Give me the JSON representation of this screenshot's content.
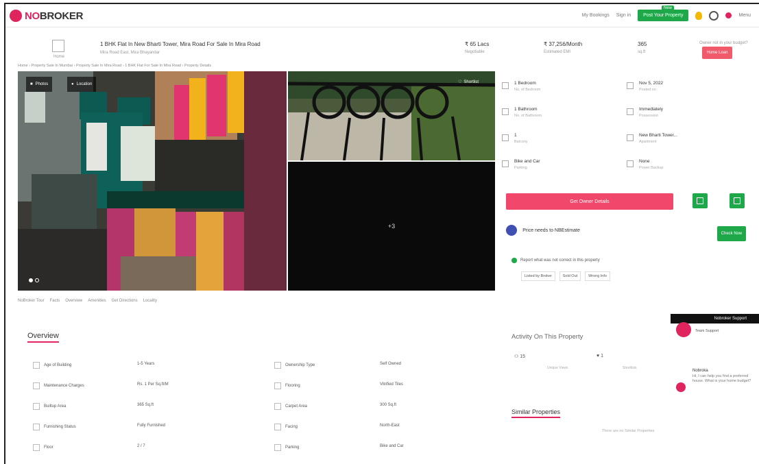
{
  "nav": {
    "logo_text_pre": "NO",
    "logo_text_post": "BROKER",
    "bookings": "My Bookings",
    "signin": "Sign in",
    "post_property": "Post Your Property",
    "new_badge": "New",
    "menu": "Menu"
  },
  "property": {
    "home_caption": "Home",
    "title": "1 BHK Flat In New Bharti Tower, Mira Road For Sale In Mira Road",
    "subtitle": "Mira Road East, Mira Bhayandar",
    "price": "₹ 65 Lacs",
    "price_label": "Negotiable",
    "emi": "₹ 37,256/Month",
    "emi_label": "Estimated EMI",
    "area": "365",
    "area_label": "sq.ft",
    "contact_caption": "Owner not in your budget?",
    "contact_button": "Home Loan",
    "breadcrumb": "Home › Property Sale In Mumbai › Property Sale In Mira Road › 1 BHK Flat For Sale In Mira Road › Property Details"
  },
  "gallery": {
    "photos_label": "Photos",
    "location_label": "Location",
    "shortlist_label": "Shortlist",
    "more_count": "+3",
    "tabs": [
      "NoBroker Tour",
      "Facts",
      "Overview",
      "Amenities",
      "Get Directions",
      "Locality"
    ]
  },
  "details": [
    {
      "value": "1 Bedroom",
      "label": "No. of Bedroom"
    },
    {
      "value": "Nov 5, 2022",
      "label": "Posted on"
    },
    {
      "value": "1 Bathroom",
      "label": "No. of Bathroom"
    },
    {
      "value": "Immediately",
      "label": "Possession"
    },
    {
      "value": "1",
      "label": "Balcony"
    },
    {
      "value": "New Bharti Tower...",
      "label": "Apartment"
    },
    {
      "value": "Bike and Car",
      "label": "Parking"
    },
    {
      "value": "None",
      "label": "Power Backup"
    }
  ],
  "actions": {
    "owner_details": "Get Owner Details",
    "price_title": "Price needs to NBEstimate",
    "check_now": "Check Now",
    "report": "Report what was not correct in this property",
    "tags": [
      "Listed by Broker",
      "Sold Out",
      "Wrong Info"
    ]
  },
  "overview": {
    "title": "Overview",
    "rows": [
      {
        "label": "Age of Building",
        "value": "1-5 Years",
        "label2": "Ownership Type",
        "value2": "Self Owned"
      },
      {
        "label": "Maintenance Charges",
        "value": "Rs. 1 Per Sq.ft/M",
        "label2": "Flooring",
        "value2": "Vitrified Tiles"
      },
      {
        "label": "Builtup Area",
        "value": "365 Sq.ft",
        "label2": "Carpet Area",
        "value2": "300 Sq.ft"
      },
      {
        "label": "Furnishing Status",
        "value": "Fully Furnished",
        "label2": "Facing",
        "value2": "North-East"
      },
      {
        "label": "Floor",
        "value": "2 / 7",
        "label2": "Parking",
        "value2": "Bike and Car"
      }
    ]
  },
  "activity": {
    "title": "Activity On This Property",
    "views": "15",
    "views_label": "Unique Views",
    "shortlists": "1",
    "shortlists_label": "Shortlists"
  },
  "similar": {
    "title": "Similar Properties",
    "empty": "There are no Similar Properties"
  },
  "chat": {
    "bar_label": "Nobroker Support",
    "agent": "Team Support",
    "sender": "Nobroka",
    "message": "Hi, I can help you find a preferred house. What is your home budget?"
  }
}
